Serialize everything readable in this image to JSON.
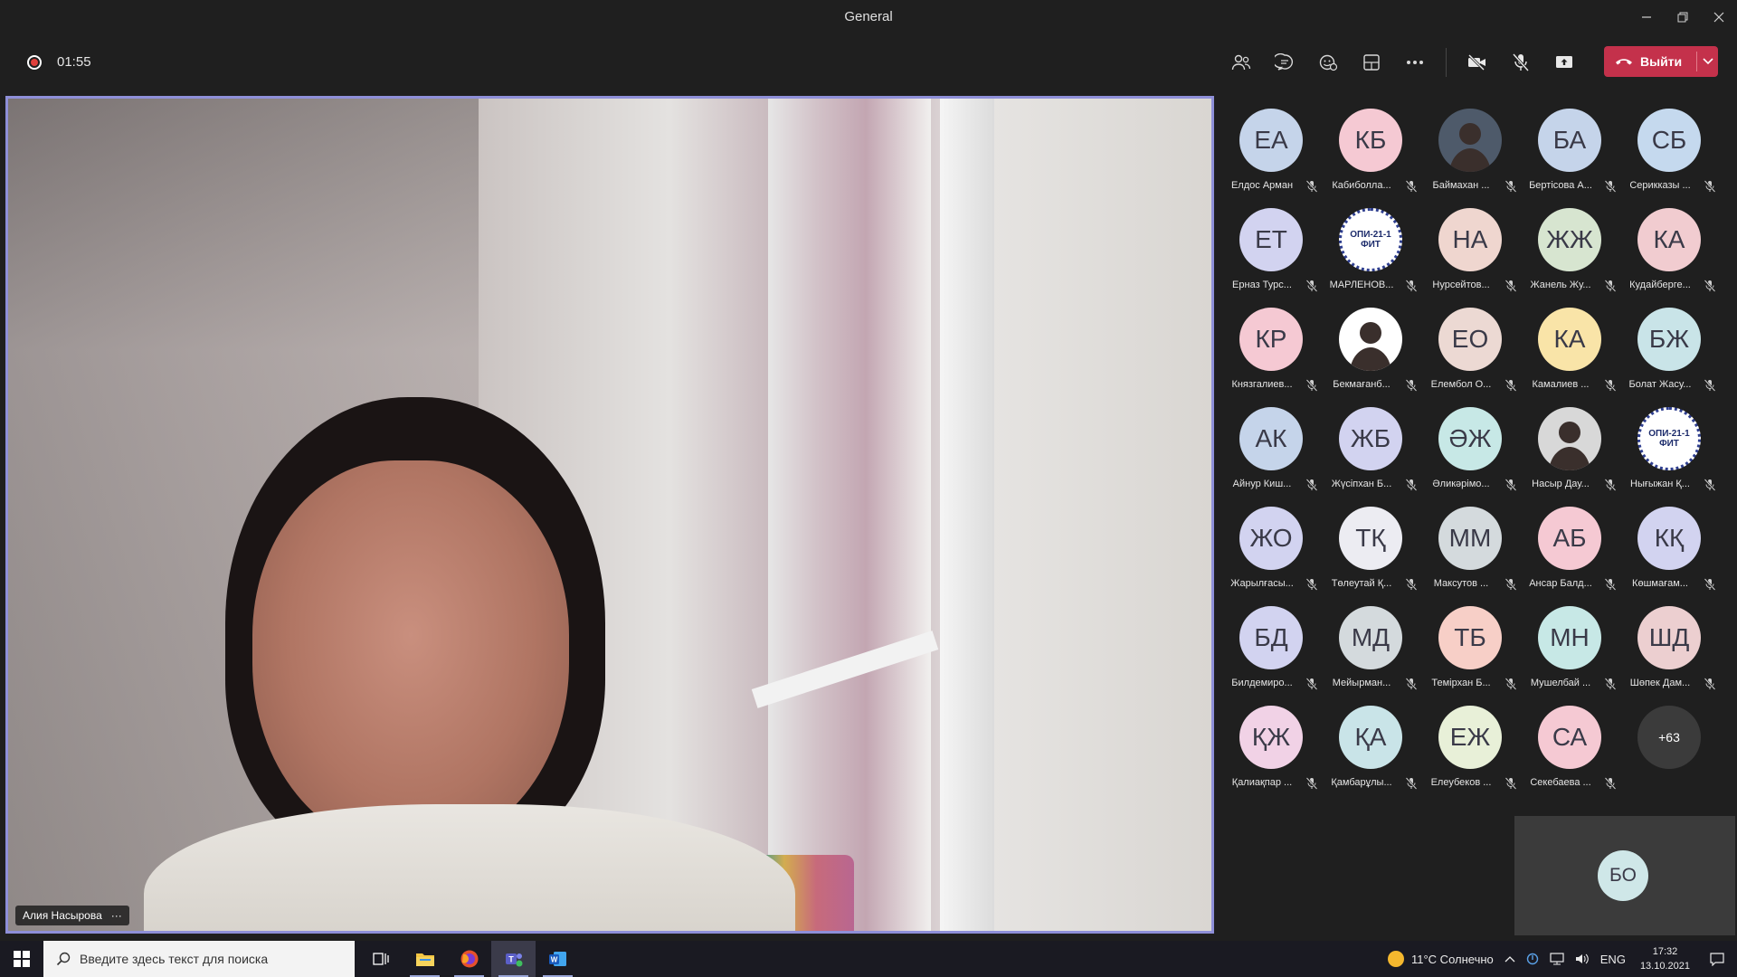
{
  "window": {
    "title": "General"
  },
  "toolbar": {
    "timer": "01:55",
    "leave_label": "Выйти"
  },
  "main_video": {
    "participant_name": "Алия Насырова",
    "more": "···"
  },
  "participants": [
    {
      "initials": "ЕА",
      "name": "Елдос Арман",
      "color": "#c5d4ea"
    },
    {
      "initials": "КБ",
      "name": "Кабиболла...",
      "color": "#f5c9d3"
    },
    {
      "initials": "",
      "name": "Баймахан ...",
      "color": "#4e5a6a",
      "photo": true
    },
    {
      "initials": "БА",
      "name": "Бертісова А...",
      "color": "#c5d4ea"
    },
    {
      "initials": "СБ",
      "name": "Серикказы ...",
      "color": "#c5d9ee"
    },
    {
      "initials": "ЕТ",
      "name": "Ерназ Турс...",
      "color": "#d2d3f0"
    },
    {
      "initials": "ОПИ-21-1 ФИТ",
      "name": "МАРЛЕНОВ...",
      "color": "#ffffff",
      "logo": true
    },
    {
      "initials": "НА",
      "name": "Нурсейтов...",
      "color": "#efd6cf"
    },
    {
      "initials": "ЖЖ",
      "name": "Жанель Жу...",
      "color": "#d7e5d0"
    },
    {
      "initials": "КА",
      "name": "Кудайберге...",
      "color": "#f1ccd0"
    },
    {
      "initials": "КР",
      "name": "Князгалиев...",
      "color": "#f5c9d3"
    },
    {
      "initials": "",
      "name": "Бекмағанб...",
      "color": "#ffffff",
      "photo": true
    },
    {
      "initials": "ЕО",
      "name": "Елембол О...",
      "color": "#ecd9d3"
    },
    {
      "initials": "КА",
      "name": "Камалиев ...",
      "color": "#f9e4a8"
    },
    {
      "initials": "БЖ",
      "name": "Болат Жасу...",
      "color": "#c9e4e8"
    },
    {
      "initials": "АК",
      "name": "Айнур Киш...",
      "color": "#c5d4ea"
    },
    {
      "initials": "ЖБ",
      "name": "Жүсіпхан Б...",
      "color": "#d2d3f0"
    },
    {
      "initials": "ӘЖ",
      "name": "Әликәрімо...",
      "color": "#c7e8e6"
    },
    {
      "initials": "",
      "name": "Насыр Дау...",
      "color": "#d8d8d8",
      "photo": true
    },
    {
      "initials": "ОПИ-21-1 ФИТ",
      "name": "Нығыжан Қ...",
      "color": "#ffffff",
      "logo": true
    },
    {
      "initials": "ЖО",
      "name": "Жарылғасы...",
      "color": "#d2d3f0"
    },
    {
      "initials": "ТҚ",
      "name": "Төлеутай Қ...",
      "color": "#ececf2"
    },
    {
      "initials": "ММ",
      "name": "Максутов ...",
      "color": "#d4dadd"
    },
    {
      "initials": "АБ",
      "name": "Ансар Балд...",
      "color": "#f5c9d3"
    },
    {
      "initials": "КҚ",
      "name": "Көшмағам...",
      "color": "#d2d3f0"
    },
    {
      "initials": "БД",
      "name": "Билдемиро...",
      "color": "#d2d3f0"
    },
    {
      "initials": "МД",
      "name": "Мейырман...",
      "color": "#d4dadd"
    },
    {
      "initials": "ТБ",
      "name": "Темірхан Б...",
      "color": "#f7cfc7"
    },
    {
      "initials": "МН",
      "name": "Мушелбай ...",
      "color": "#c7e8e6"
    },
    {
      "initials": "ШД",
      "name": "Шөпек Дам...",
      "color": "#eccfd0"
    },
    {
      "initials": "ҚЖ",
      "name": "Қалиақпар ...",
      "color": "#f1d2e6"
    },
    {
      "initials": "ҚА",
      "name": "Қамбарұлы...",
      "color": "#c9e4e8"
    },
    {
      "initials": "ЕЖ",
      "name": "Елеубеков ...",
      "color": "#e8f0d8"
    },
    {
      "initials": "СА",
      "name": "Секебаева ...",
      "color": "#f5c9d3"
    }
  ],
  "more_participants": "+63",
  "self_preview": {
    "initials": "БО"
  },
  "taskbar": {
    "search_placeholder": "Введите здесь текст для поиска",
    "weather": "11°C Солнечно",
    "lang": "ENG",
    "time": "17:32",
    "date": "13.10.2021"
  }
}
